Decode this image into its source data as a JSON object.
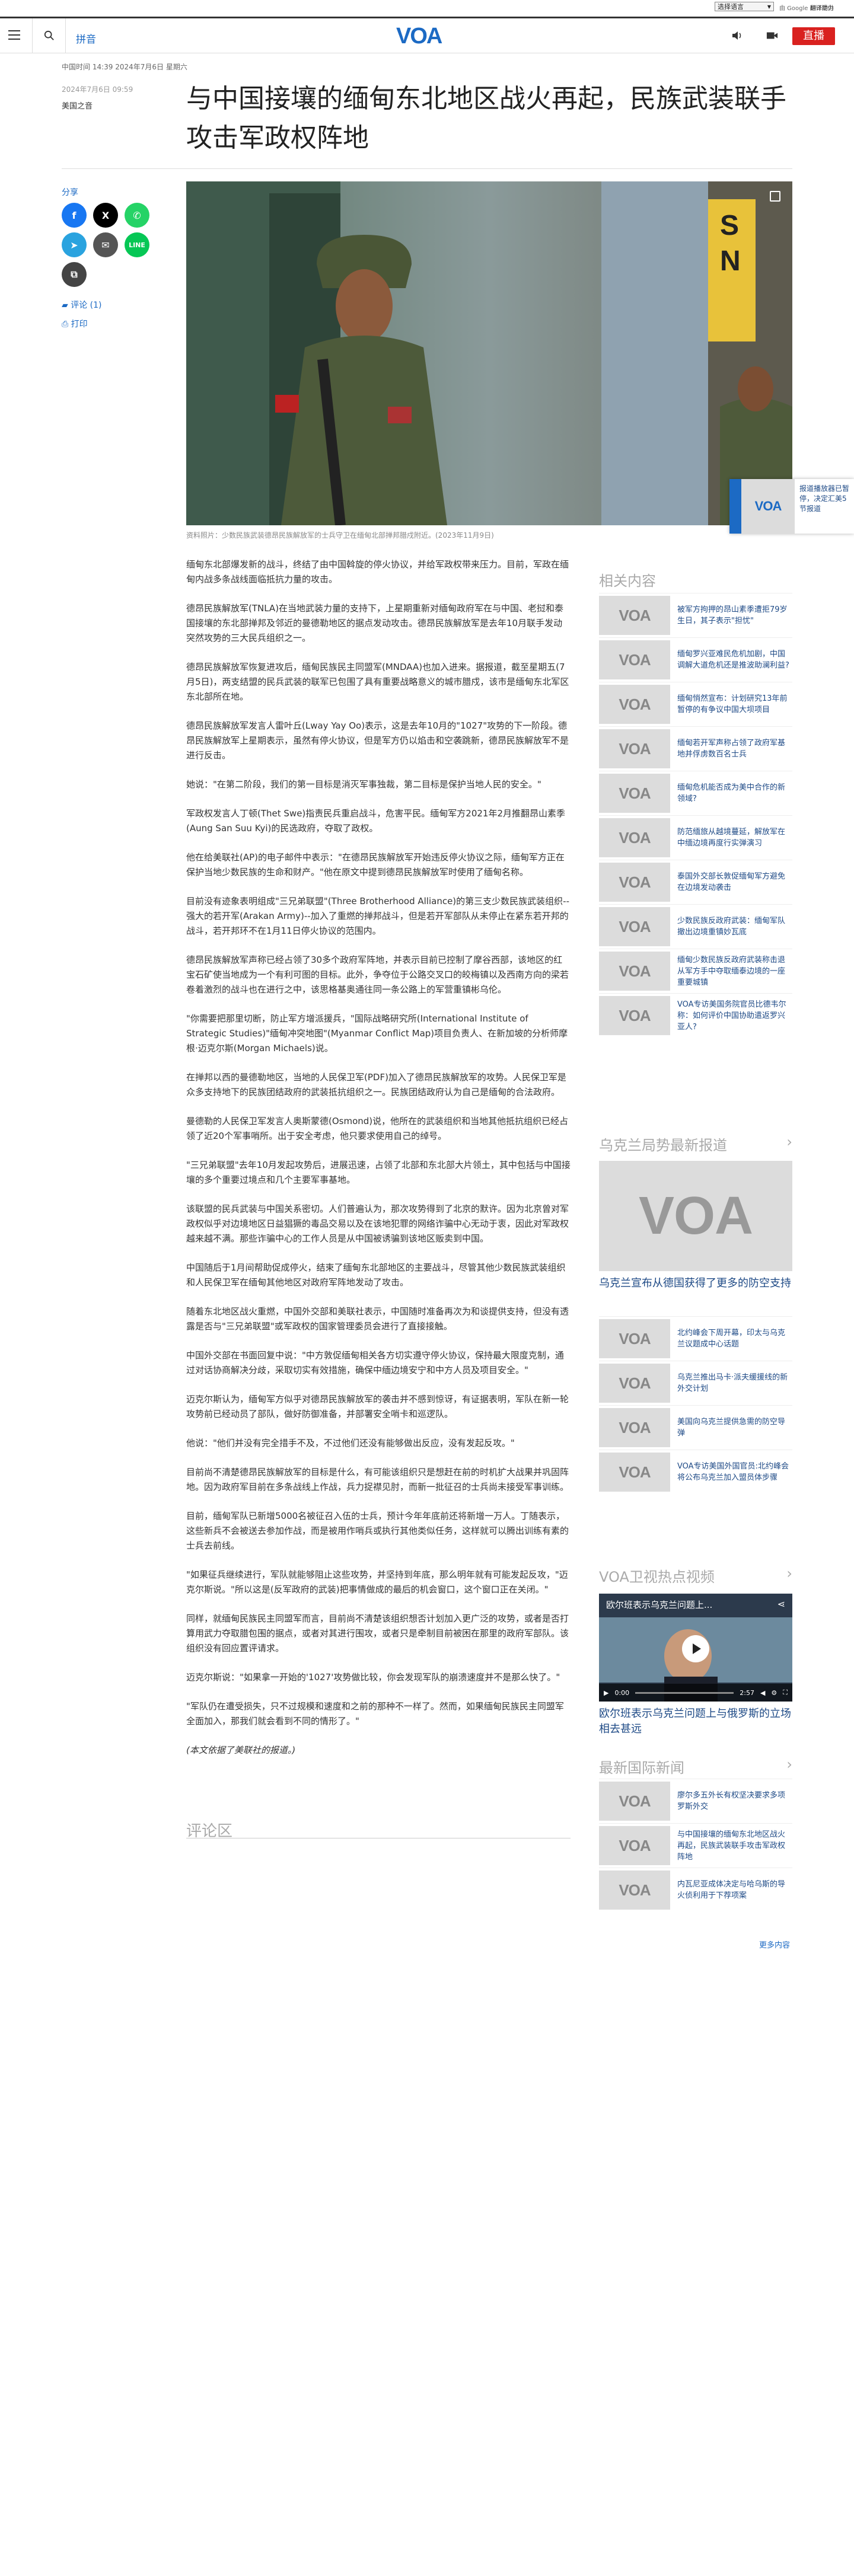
{
  "topbar": {
    "lang": "选择语言",
    "gtr": "由 Google 翻译提供",
    "gtr2": "翻译助力"
  },
  "header": {
    "pinyin": "拼音",
    "logo": "VOA",
    "live": "直播"
  },
  "meta": {
    "dateline": "中国时间 14:39 2024年7月6日 星期六",
    "updated": "2024年7月6日 09:59",
    "source": "美国之音"
  },
  "title": "与中国接壤的缅甸东北地区战火再起，民族武装联手攻击军政权阵地",
  "share": {
    "label": "分享",
    "comments": "评论 (1)",
    "print": "打印"
  },
  "caption": "资料照片：少数民族武装德昂民族解放军的士兵守卫在缅甸北部掸邦腊戍附近。(2023年11月9日)",
  "paragraphs": [
    "缅甸东北部爆发新的战斗，终结了由中国斡旋的停火协议，并给军政权带来压力。目前，军政在缅甸内战多条战线面临抵抗力量的攻击。",
    "德昂民族解放军(TNLA)在当地武装力量的支持下，上星期重新对缅甸政府军在与中国、老挝和泰国接壤的东北部掸邦及邻近的曼德勒地区的据点发动攻击。德昂民族解放军是去年10月联手发动突然攻势的三大民兵组织之一。",
    "德昂民族解放军恢复进攻后，缅甸民族民主同盟军(MNDAA)也加入进来。据报道，截至星期五(7月5日)，两支结盟的民兵武装的联军已包围了具有重要战略意义的城市腊戍，该市是缅甸东北军区东北部所在地。",
    "德昂民族解放军发言人雷叶丘(Lway Yay Oo)表示，这是去年10月的\"1027\"攻势的下一阶段。德昂民族解放军上星期表示，虽然有停火协议，但是军方仍以焰击和空袭跳新，德昂民族解放军不是进行反击。",
    "她说：\"在第二阶段，我们的第一目标是消灭军事独裁，第二目标是保护当地人民的安全。\"",
    "军政权发言人丁顿(Thet Swe)指责民兵重启战斗，危害平民。缅甸军方2021年2月推翻昂山素季(Aung San Suu Kyi)的民选政府，夺取了政权。",
    "他在给美联社(AP)的电子邮件中表示：\"在德昂民族解放军开始违反停火协议之际，缅甸军方正在保护当地少数民族的生命和财产。\"他在原文中提到德昂民族解放军时使用了缅甸名称。",
    "目前没有迹象表明组成\"三兄弟联盟\"(Three Brotherhood Alliance)的第三支少数民族武装组织--强大的若开军(Arakan Army)--加入了重燃的掸邦战斗，但是若开军部队从未停止在紧东若开邦的战斗，若开邦环不在1月11日停火协议的范围内。",
    "德昂民族解放军声称已经占领了30多个政府军阵地，并表示目前已控制了摩谷西部，该地区的红宝石矿使当地成为一个有利可图的目标。此外，争夺位于公路交叉口的皎梅镇以及西南方向的梁若卷着激烈的战斗也在进行之中，该思格基奥通往同一条公路上的军营重镇彬乌伦。",
    "\"你需要把那里切断，防止军方增派援兵，\"国际战略研究所(International Institute of Strategic Studies)\"缅甸冲突地图\"(Myanmar Conflict Map)项目负责人、在新加坡的分析师摩根·迈克尔斯(Morgan Michaels)说。",
    "在掸邦以西的曼德勒地区，当地的人民保卫军(PDF)加入了德昂民族解放军的攻势。人民保卫军是众多支持地下的民族团结政府的武装抵抗组织之一。民族团结政府认为自己是缅甸的合法政府。",
    "曼德勒的人民保卫军发言人奥斯蒙德(Osmond)说，他所在的武装组织和当地其他抵抗组织已经占领了近20个军事哨所。出于安全考虑，他只要求使用自己的绰号。",
    "\"三兄弟联盟\"去年10月发起攻势后，进展迅速，占领了北部和东北部大片领土，其中包括与中国接壤的多个重要过境点和几个主要军事基地。",
    "该联盟的民兵武装与中国关系密切。人们普遍认为，那次攻势得到了北京的默许。因为北京曾对军政权似乎对边境地区日益猖獗的毒品交易以及在该地犯罪的网络诈骗中心无动于衷，因此对军政权越来越不满。那些诈骗中心的工作人员是从中国被诱骗到该地区贩卖到中国。",
    "中国随后于1月间帮助促成停火，结束了缅甸东北部地区的主要战斗，尽管其他少数民族武装组织和人民保卫军在缅甸其他地区对政府军阵地发动了攻击。",
    "随着东北地区战火重燃，中国外交部和美联社表示，中国随时准备再次为和谈提供支持，但没有透露是否与\"三兄弟联盟\"或军政权的国家管理委员会进行了直接接触。",
    "中国外交部在书面回复中说：\"中方敦促缅甸相关各方切实遵守停火协议，保持最大限度克制，通过对话协商解决分歧，采取切实有效措施，确保中缅边境安宁和中方人员及项目安全。\"",
    "迈克尔斯认为，缅甸军方似乎对德昂民族解放军的袭击并不感到惊讶，有证据表明，军队在新一轮攻势前已经动员了部队，做好防御准备，并部署安全哨卡和巡逻队。",
    "他说：\"他们并没有完全措手不及，不过他们还没有能够做出反应，没有发起反攻。\"",
    "目前尚不清楚德昂民族解放军的目标是什么，有可能该组织只是想赶在前的时机扩大战果并巩固阵地。因为政府军目前在多条战线上作战，兵力捉襟见肘，而新一批征召的士兵尚未接受军事训练。",
    "目前，缅甸军队已新增5000名被征召入伍的士兵，预计今年年底前还将新增一万人。丁随表示，这些新兵不会被送去参加作战，而是被用作哨兵或执行其他类似任务，这样就可以腾出训练有素的士兵去前线。",
    "\"如果征兵继续进行，军队就能够阻止这些攻势，并坚持到年底，那么明年就有可能发起反攻，\"迈克尔斯说。\"所以这是(反军政府的武装)把事情做成的最后的机会窗口，这个窗口正在关闭。\"",
    "同样，就缅甸民族民主同盟军而言，目前尚不清楚该组织想否计划加入更广泛的攻势，或者是否打算用武力夺取腊包围的据点，或者对其进行围攻，或者只是牵制目前被困在那里的政府军部队。该组织没有回应置评请求。",
    "迈克尔斯说：\"如果拿一开始的'1027'攻势做比较，你会发现军队的崩溃速度并不是那么快了。\"",
    "\"军队仍在遭受损失，只不过规模和速度和之前的那种不一样了。然而，如果缅甸民族民主同盟军全面加入，那我们就会看到不同的情形了。\"",
    "(本文依据了美联社的报道。)"
  ],
  "comments_heading": "评论区",
  "related": {
    "heading": "相关内容",
    "items": [
      "被军方拘押的昂山素季遭拒79岁生日，其子表示\"担忧\"",
      "缅甸罗兴亚难民危机加剧，中国调解大道危机还是推波助澜利益?",
      "缅甸悄然宣布：计划研究13年前暂停的有争议中国大坝项目",
      "缅甸若开军声称占领了政府军基地并俘虏数百名士兵",
      "缅甸危机能否成为美中合作的新领域?",
      "防范缅旅从越境蔓延，解放军在中缅边境再度行实弹演习",
      "泰国外交部长敦促缅甸军方避免在边境发动袭击",
      "少数民族反政府武装：缅甸军队撤出边境重镇妙瓦底",
      "缅甸少数民族反政府武装称击退从军方手中夺取缅泰边境的一座重要城镇",
      "VOA专访美国务院官员比德韦尔称：如何评价中国协助遣返罗兴亚人?"
    ]
  },
  "ukraine": {
    "heading": "乌克兰局势最新报道",
    "feature": "乌克兰宣布从德国获得了更多的防空支持",
    "items": [
      "北约峰会下周开幕，印太与乌克兰议题成中心话题",
      "乌克兰推出马卡·派夫缓援线的新外交计划",
      "美国向乌克兰提供急需的防空导弹",
      "VOA专访美国外国官员:北约峰会将公布乌克兰加入盟员体步骤"
    ]
  },
  "video": {
    "heading": "VOA卫视热点视频",
    "title": "欧尔班表示乌克兰问题上与俄罗斯的立场相去甚远",
    "overlay": "欧尔班表示乌克兰问题上...",
    "time1": "0:00",
    "time2": "2:57"
  },
  "intl": {
    "heading": "最新国际新闻",
    "items": [
      "廖尔多五外长有权坚决要求多项罗斯外交",
      "与中国接壤的缅甸东北地区战火再起，民族武装联手攻击军政权阵地",
      "内瓦尼亚成体决定与哈乌斯的导火侦利用于下荐项案"
    ],
    "more": "更多内容"
  },
  "float": {
    "text": "报道播放器已暂停，决定汇美5节报道"
  }
}
